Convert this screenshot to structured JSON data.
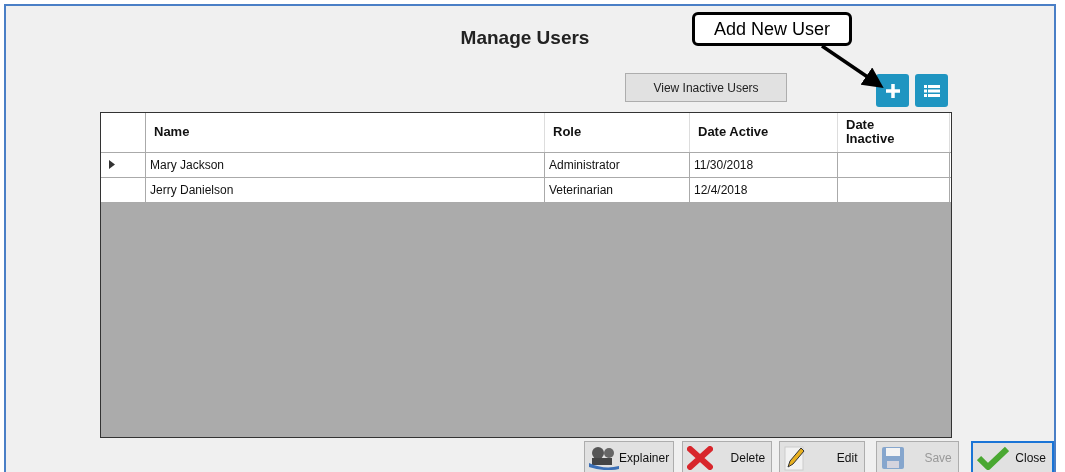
{
  "window": {
    "title": "Manage Users"
  },
  "callout": {
    "text": "Add New User"
  },
  "view_inactive_button": {
    "label": "View Inactive Users"
  },
  "table": {
    "columns": [
      "Name",
      "Role",
      "Date Active",
      "Date\nInactive"
    ],
    "rows": [
      {
        "selected": true,
        "cells": [
          "Mary Jackson",
          "Administrator",
          "11/30/2018",
          ""
        ]
      },
      {
        "selected": false,
        "cells": [
          "Jerry Danielson",
          "Veterinarian",
          "12/4/2018",
          ""
        ]
      }
    ]
  },
  "buttons": [
    {
      "kind": "explainer",
      "label": "Explainer",
      "disabled": false,
      "focused": false
    },
    {
      "kind": "delete",
      "label": "Delete",
      "disabled": false,
      "focused": false
    },
    {
      "kind": "edit",
      "label": "Edit",
      "disabled": false,
      "focused": false
    },
    {
      "kind": "save",
      "label": "Save",
      "disabled": true,
      "focused": false
    },
    {
      "kind": "close",
      "label": "Close",
      "disabled": false,
      "focused": true
    }
  ]
}
